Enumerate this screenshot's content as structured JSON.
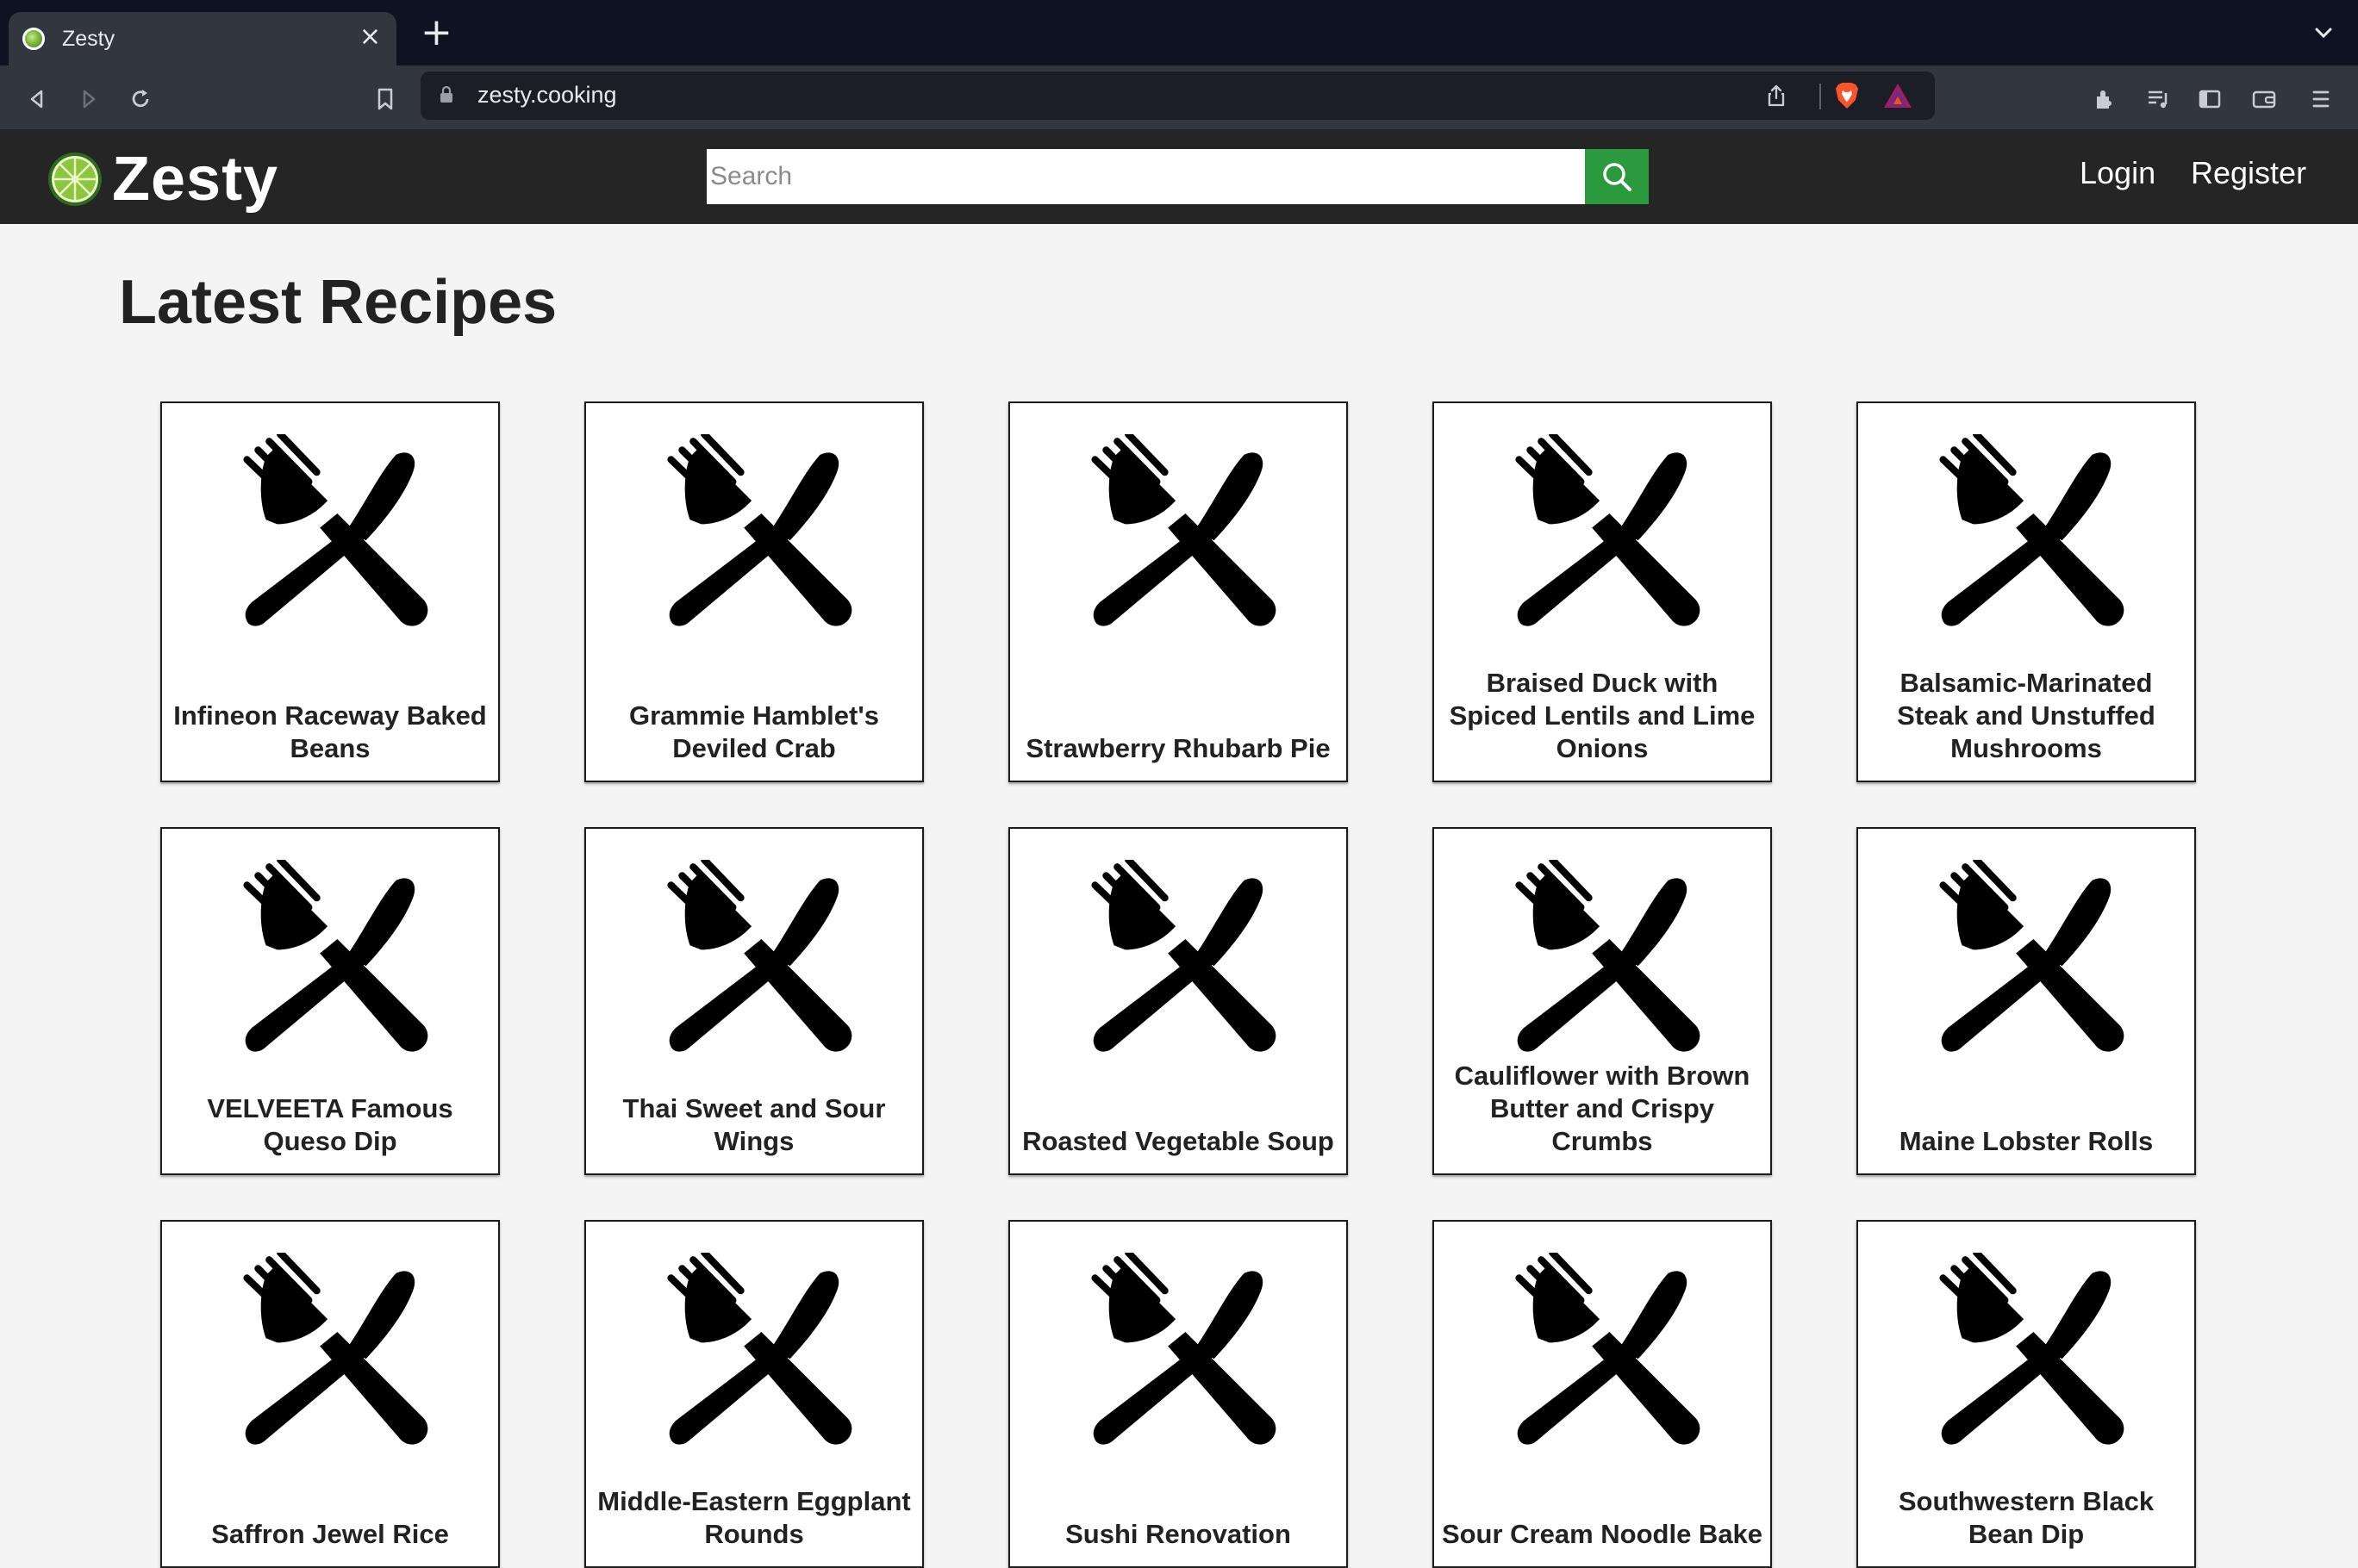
{
  "browser": {
    "tab_title": "Zesty",
    "close_glyph": "×",
    "new_tab_glyph": "+",
    "tab_menu_glyph": "⌄",
    "url": "zesty.cooking"
  },
  "header": {
    "logo_text": "Zesty",
    "search_placeholder": "Search",
    "search_value": "",
    "nav": {
      "login": "Login",
      "register": "Register"
    },
    "colors": {
      "header_bg": "#252525",
      "search_button": "#2b9a3f"
    }
  },
  "main": {
    "title": "Latest Recipes",
    "recipes": [
      {
        "title": "Infineon Raceway Baked Beans",
        "icon": "fork-knife-icon"
      },
      {
        "title": "Grammie Hamblet's Deviled Crab",
        "icon": "fork-knife-icon"
      },
      {
        "title": "Strawberry Rhubarb Pie",
        "icon": "fork-knife-icon"
      },
      {
        "title": "Braised Duck with Spiced Lentils and Lime Onions",
        "icon": "fork-knife-icon"
      },
      {
        "title": "Balsamic-Marinated Steak and Unstuffed Mushrooms",
        "icon": "fork-knife-icon"
      },
      {
        "title": "VELVEETA Famous Queso Dip",
        "icon": "fork-knife-icon"
      },
      {
        "title": "Thai Sweet and Sour Wings",
        "icon": "fork-knife-icon"
      },
      {
        "title": "Roasted Vegetable Soup",
        "icon": "fork-knife-icon"
      },
      {
        "title": "Cauliflower with Brown Butter and Crispy Crumbs",
        "icon": "fork-knife-icon"
      },
      {
        "title": "Maine Lobster Rolls",
        "icon": "fork-knife-icon"
      },
      {
        "title": "Saffron Jewel Rice",
        "icon": "fork-knife-icon"
      },
      {
        "title": "Middle-Eastern Eggplant Rounds",
        "icon": "fork-knife-icon"
      },
      {
        "title": "Sushi Renovation",
        "icon": "fork-knife-icon"
      },
      {
        "title": "Sour Cream Noodle Bake",
        "icon": "fork-knife-icon"
      },
      {
        "title": "Southwestern Black Bean Dip",
        "icon": "fork-knife-icon"
      }
    ]
  }
}
